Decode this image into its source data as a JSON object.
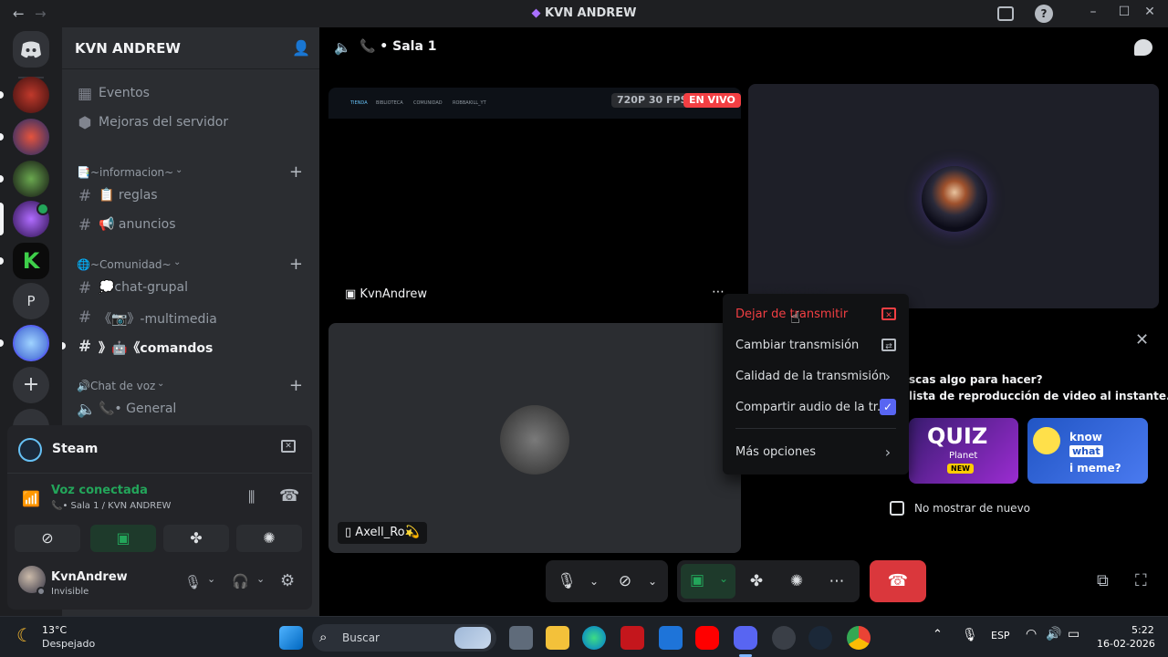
{
  "window": {
    "title": "KVN ANDREW",
    "back_glyph": "←",
    "forward_glyph": "→"
  },
  "server": {
    "name": "KVN ANDREW",
    "rail_letter": "P"
  },
  "sidebar": {
    "top_items": [
      {
        "label": "Eventos",
        "icon": "calendar-icon"
      },
      {
        "label": "Mejoras del servidor",
        "icon": "boost-icon"
      }
    ],
    "categories": [
      {
        "label": "📑~informacion~",
        "channels": [
          "📋 reglas",
          "📢 anuncios"
        ]
      },
      {
        "label": "🌐~Comunidad~",
        "channels": [
          "💭chat-grupal",
          "《📷》-multimedia",
          "》🤖《comandos"
        ]
      },
      {
        "label": "🔊Chat de voz",
        "channels": [
          "📞• General"
        ]
      }
    ]
  },
  "activity_card": {
    "name": "Steam"
  },
  "voice_status": {
    "title": "Voz conectada",
    "subtitle": "📞• Sala 1 / KVN ANDREW",
    "color": "#23a55a"
  },
  "user": {
    "name": "KvnAndrew",
    "status": "Invisible"
  },
  "call": {
    "channel": "📞 • Sala 1",
    "stream_owner": "KvnAndrew",
    "quality_badge": "720P 30 FPS",
    "live_badge": "EN VIVO",
    "second_user": "Axell_Ro💫",
    "hidden_name": "KvnAndrew"
  },
  "stream_preview": {
    "menu": [
      "TIENDA",
      "BIBLIOTECA",
      "COMUNIDAD",
      "ROBBAKILL_YT"
    ]
  },
  "context_menu": {
    "items": [
      {
        "label": "Dejar de transmitir",
        "danger": true,
        "right": "stop-stream-icon"
      },
      {
        "label": "Cambiar transmisión",
        "right": "switch-screen-icon"
      },
      {
        "label": "Calidad de la transmisión",
        "right": "chevron-right-icon"
      },
      {
        "label": "Compartir audio de la tr...",
        "right": "checkbox-checked-icon"
      },
      {
        "label": "Más opciones",
        "right": "chevron-right-icon"
      }
    ]
  },
  "activity_panel": {
    "line1": "scas algo para hacer?",
    "line2": "lista de reproducción de video al instante.",
    "quiz_title": "QUIZ",
    "quiz_sub": "Planet",
    "quiz_tag": "NEW",
    "meme_text_1": "know",
    "meme_text_2": "what",
    "meme_text_3": "i meme?",
    "dont_show": "No mostrar de nuevo"
  },
  "taskbar": {
    "temp": "13°C",
    "weather": "Despejado",
    "search_placeholder": "Buscar",
    "lang": "ESP",
    "time": "5:22",
    "date": "16-02-2026"
  },
  "colors": {
    "danger": "#f23f43",
    "accent": "#5865f2",
    "green": "#23a55a"
  }
}
